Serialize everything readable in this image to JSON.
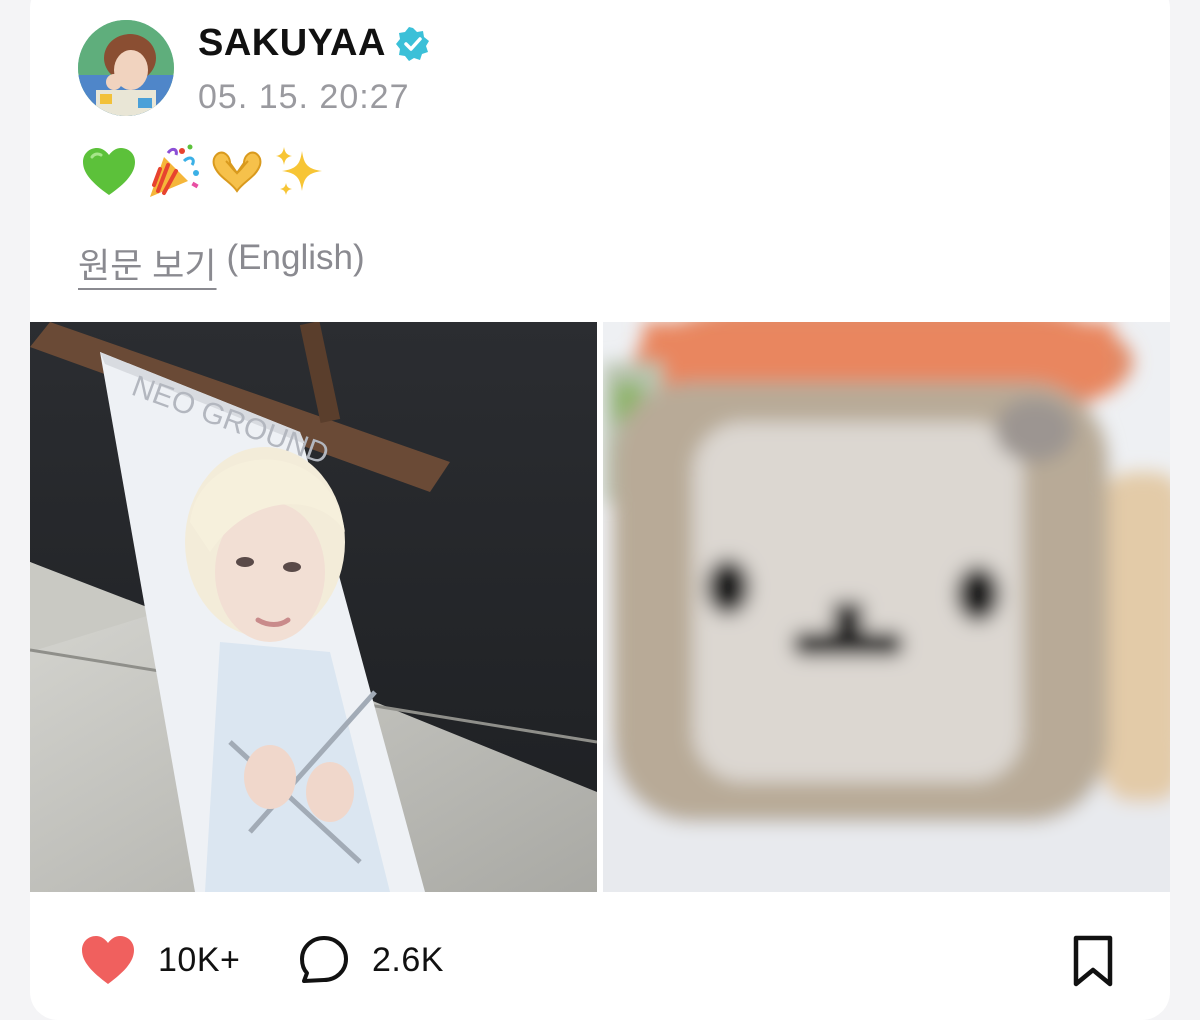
{
  "post": {
    "username": "SAKUYAA",
    "verified": true,
    "timestamp": "05. 15. 20:27",
    "emojis": [
      "green-heart",
      "party-popper",
      "heart-hands",
      "sparkles"
    ],
    "translate_link_label": "원문 보기",
    "translate_language": "(English)"
  },
  "actions": {
    "like_count": "10K+",
    "comment_count": "2.6K"
  },
  "colors": {
    "like": "#f0605e",
    "verified": "#3bc0d8",
    "muted_text": "#9a9a9f"
  }
}
